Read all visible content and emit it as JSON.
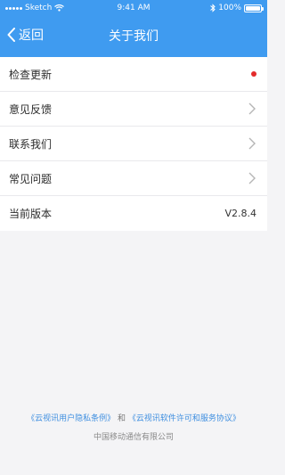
{
  "status_bar": {
    "carrier": "Sketch",
    "time": "9:41 AM",
    "battery": "100%",
    "battery_level": 1.0,
    "icons": [
      "signal-icon",
      "wifi-icon",
      "bluetooth-icon",
      "battery-icon"
    ]
  },
  "nav": {
    "back_label": "返回",
    "title": "关于我们"
  },
  "menu": {
    "items": [
      {
        "label": "检查更新",
        "indicator": "red-dot"
      },
      {
        "label": "意见反馈",
        "indicator": "chevron"
      },
      {
        "label": "联系我们",
        "indicator": "chevron"
      },
      {
        "label": "常见问题",
        "indicator": "chevron"
      },
      {
        "label": "当前版本",
        "value": "V2.8.4"
      }
    ]
  },
  "footer": {
    "privacy_link": "《云视讯用户隐私条例》",
    "and_text": "和",
    "license_link": "《云视讯软件许可和服务协议》",
    "company": "中国移动通信有限公司"
  },
  "colors": {
    "header": "#3f9bf0",
    "background": "#f4f4f6",
    "dot": "#e32b2b",
    "link": "#3f8fe0"
  }
}
